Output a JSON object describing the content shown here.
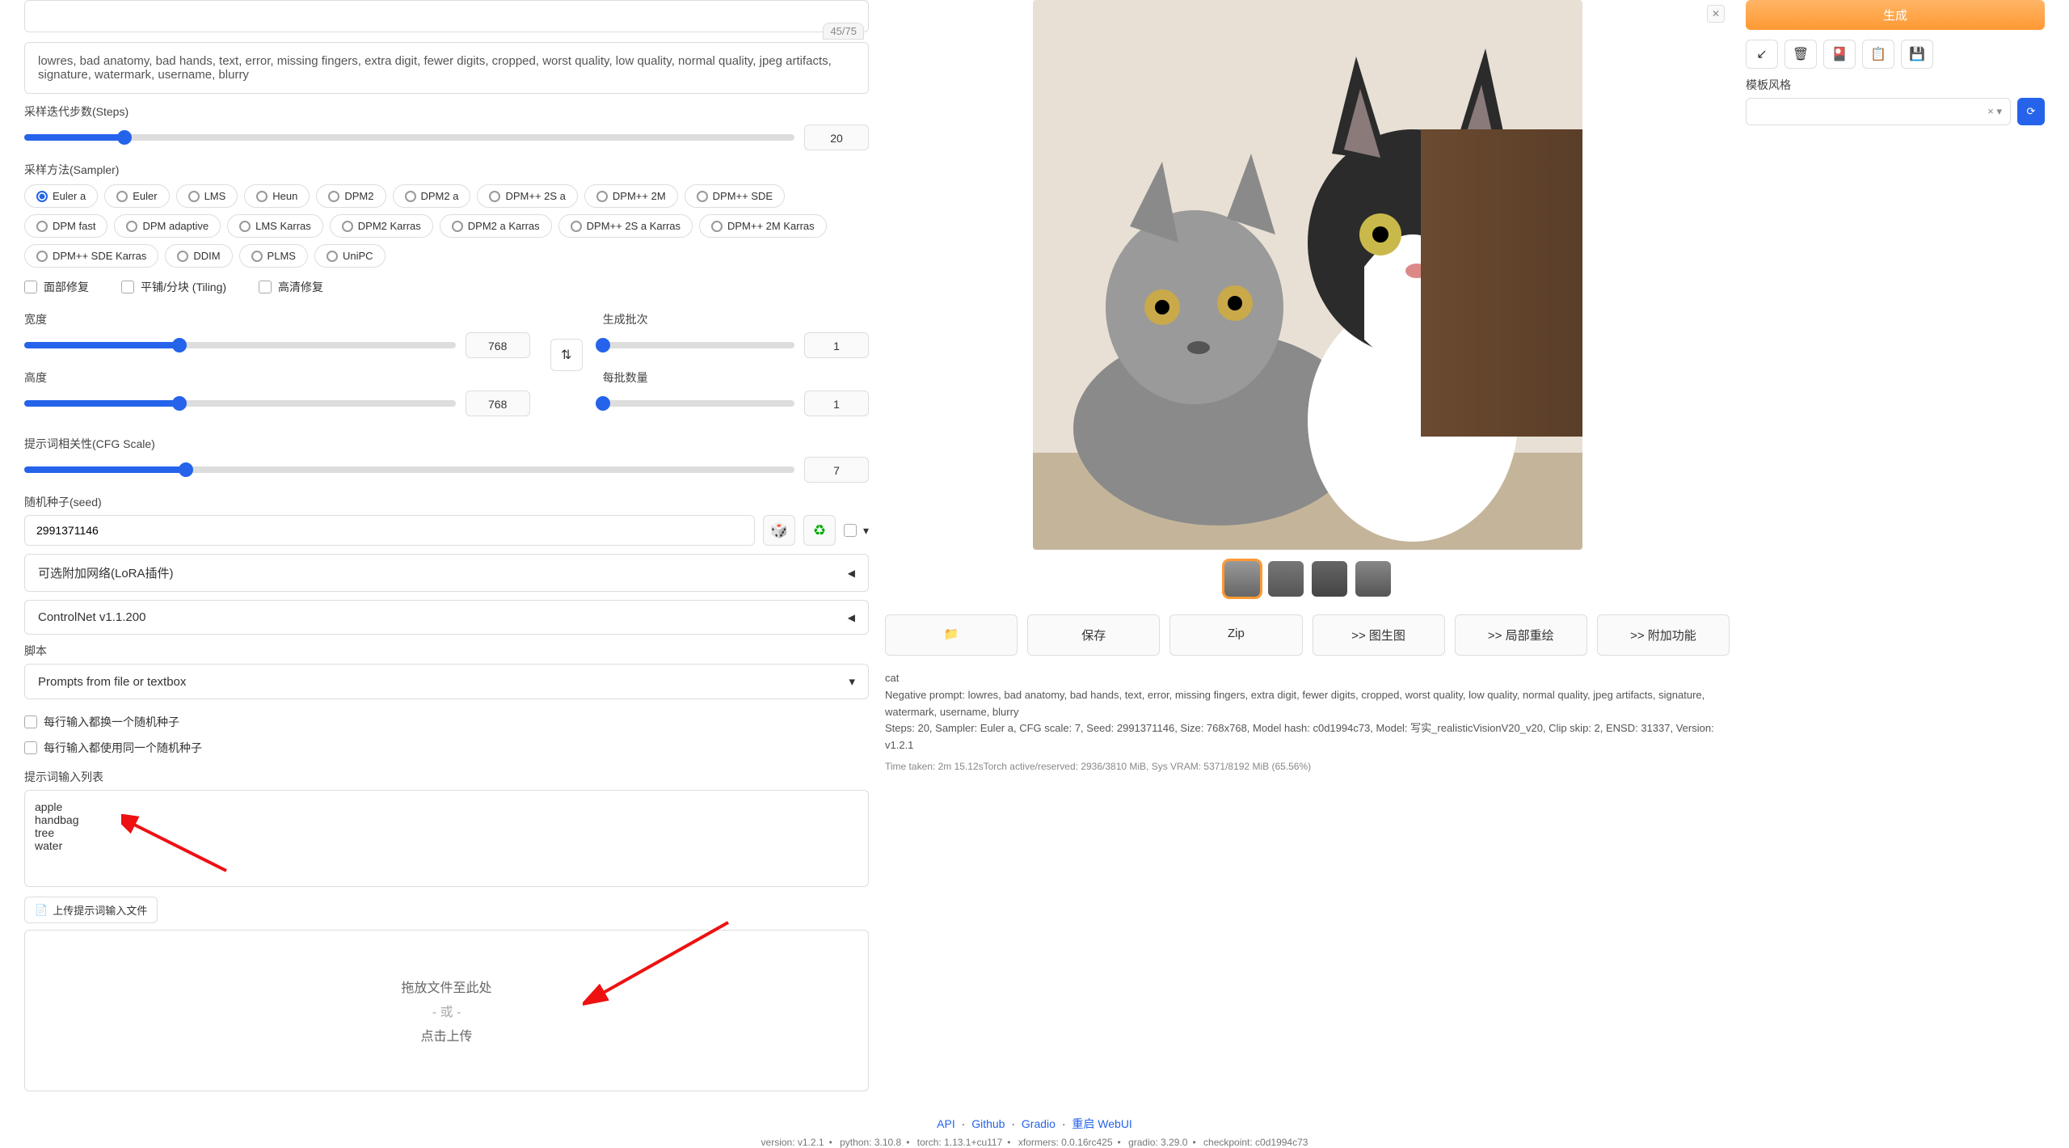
{
  "negative_prompt": "lowres, bad anatomy, bad hands, text, error, missing fingers, extra digit, fewer digits, cropped, worst quality, low quality, normal quality, jpeg artifacts, signature, watermark, username, blurry",
  "token_count": "45/75",
  "labels": {
    "steps": "采样迭代步数(Steps)",
    "sampler": "采样方法(Sampler)",
    "face": "面部修复",
    "tiling": "平铺/分块 (Tiling)",
    "hires": "高清修复",
    "width": "宽度",
    "height": "高度",
    "batch_count": "生成批次",
    "batch_size": "每批数量",
    "cfg": "提示词相关性(CFG Scale)",
    "seed": "随机种子(seed)",
    "script": "脚本",
    "random_each": "每行输入都换一个随机种子",
    "same_random": "每行输入都使用同一个随机种子",
    "prompt_list": "提示词输入列表",
    "upload_btn": "上传提示词输入文件",
    "drop1": "拖放文件至此处",
    "drop2": "- 或 -",
    "drop3": "点击上传",
    "style_label": "模板风格"
  },
  "values": {
    "steps": "20",
    "width": "768",
    "height": "768",
    "batch_count": "1",
    "batch_size": "1",
    "cfg": "7",
    "seed": "2991371146",
    "script": "Prompts from file or textbox",
    "prompt_list_text": "apple\nhandbag\ntree\nwater"
  },
  "samplers": [
    "Euler a",
    "Euler",
    "LMS",
    "Heun",
    "DPM2",
    "DPM2 a",
    "DPM++ 2S a",
    "DPM++ 2M",
    "DPM++ SDE",
    "DPM fast",
    "DPM adaptive",
    "LMS Karras",
    "DPM2 Karras",
    "DPM2 a Karras",
    "DPM++ 2S a Karras",
    "DPM++ 2M Karras",
    "DPM++ SDE Karras",
    "DDIM",
    "PLMS",
    "UniPC"
  ],
  "sampler_selected": "Euler a",
  "accordions": {
    "lora": "可选附加网络(LoRA插件)",
    "controlnet": "ControlNet v1.1.200"
  },
  "generate": "生成",
  "actions": {
    "folder": "📁",
    "save": "保存",
    "zip": "Zip",
    "img2img": ">> 图生图",
    "inpaint": ">> 局部重绘",
    "extras": ">> 附加功能"
  },
  "output": {
    "prompt": "cat",
    "negative": "Negative prompt: lowres, bad anatomy, bad hands, text, error, missing fingers, extra digit, fewer digits, cropped, worst quality, low quality, normal quality, jpeg artifacts, signature, watermark, username, blurry",
    "params": "Steps: 20, Sampler: Euler a, CFG scale: 7, Seed: 2991371146, Size: 768x768, Model hash: c0d1994c73, Model: 写实_realisticVisionV20_v20, Clip skip: 2, ENSD: 31337, Version: v1.2.1",
    "time": "Time taken: 2m 15.12sTorch active/reserved: 2936/3810 MiB, Sys VRAM: 5371/8192 MiB (65.56%)"
  },
  "footer": {
    "api": "API",
    "github": "Github",
    "gradio": "Gradio",
    "reload": "重启 WebUI",
    "version_line": {
      "version": "version: v1.2.1",
      "python": "python: 3.10.8",
      "torch": "torch: 1.13.1+cu117",
      "xformers": "xformers: 0.0.16rc425",
      "gradio": "gradio: 3.29.0",
      "checkpoint": "checkpoint: c0d1994c73"
    }
  }
}
